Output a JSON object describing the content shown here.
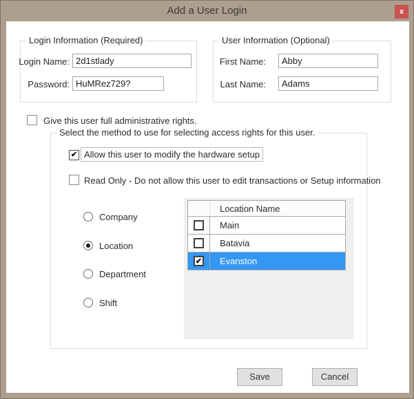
{
  "window": {
    "title": "Add a User Login",
    "close_glyph": "x"
  },
  "colors": {
    "titlebar": "#ad9e8f",
    "close_button": "#c85250",
    "selected_row": "#3397f3"
  },
  "login_group": {
    "title": "Login Information (Required)",
    "login_label": "Login Name:",
    "login_value": "2d1stlady",
    "password_label": "Password:",
    "password_value": "HuMRez729?"
  },
  "user_group": {
    "title": "User Information (Optional)",
    "first_label": "First Name:",
    "first_value": "Abby",
    "last_label": "Last Name:",
    "last_value": "Adams"
  },
  "admin_checkbox": {
    "label": "Give this user full administrative rights.",
    "checked": false
  },
  "access_group": {
    "title": "Select the method to use for selecting access rights for this user.",
    "hardware_checkbox": {
      "label": "Allow this user to modify the hardware setup",
      "checked": true
    },
    "readonly_checkbox": {
      "label": "Read Only - Do not allow this user to edit transactions or Setup information",
      "checked": false
    },
    "methods": [
      {
        "label": "Company",
        "selected": false
      },
      {
        "label": "Location",
        "selected": true
      },
      {
        "label": "Department",
        "selected": false
      },
      {
        "label": "Shift",
        "selected": false
      }
    ],
    "locations": {
      "header": "Location Name",
      "rows": [
        {
          "name": "Main",
          "checked": false,
          "selected": false
        },
        {
          "name": "Batavia",
          "checked": false,
          "selected": false
        },
        {
          "name": "Evanston",
          "checked": true,
          "selected": true
        }
      ]
    }
  },
  "buttons": {
    "save": "Save",
    "cancel": "Cancel"
  },
  "icons": {
    "check_glyph": "✔"
  }
}
